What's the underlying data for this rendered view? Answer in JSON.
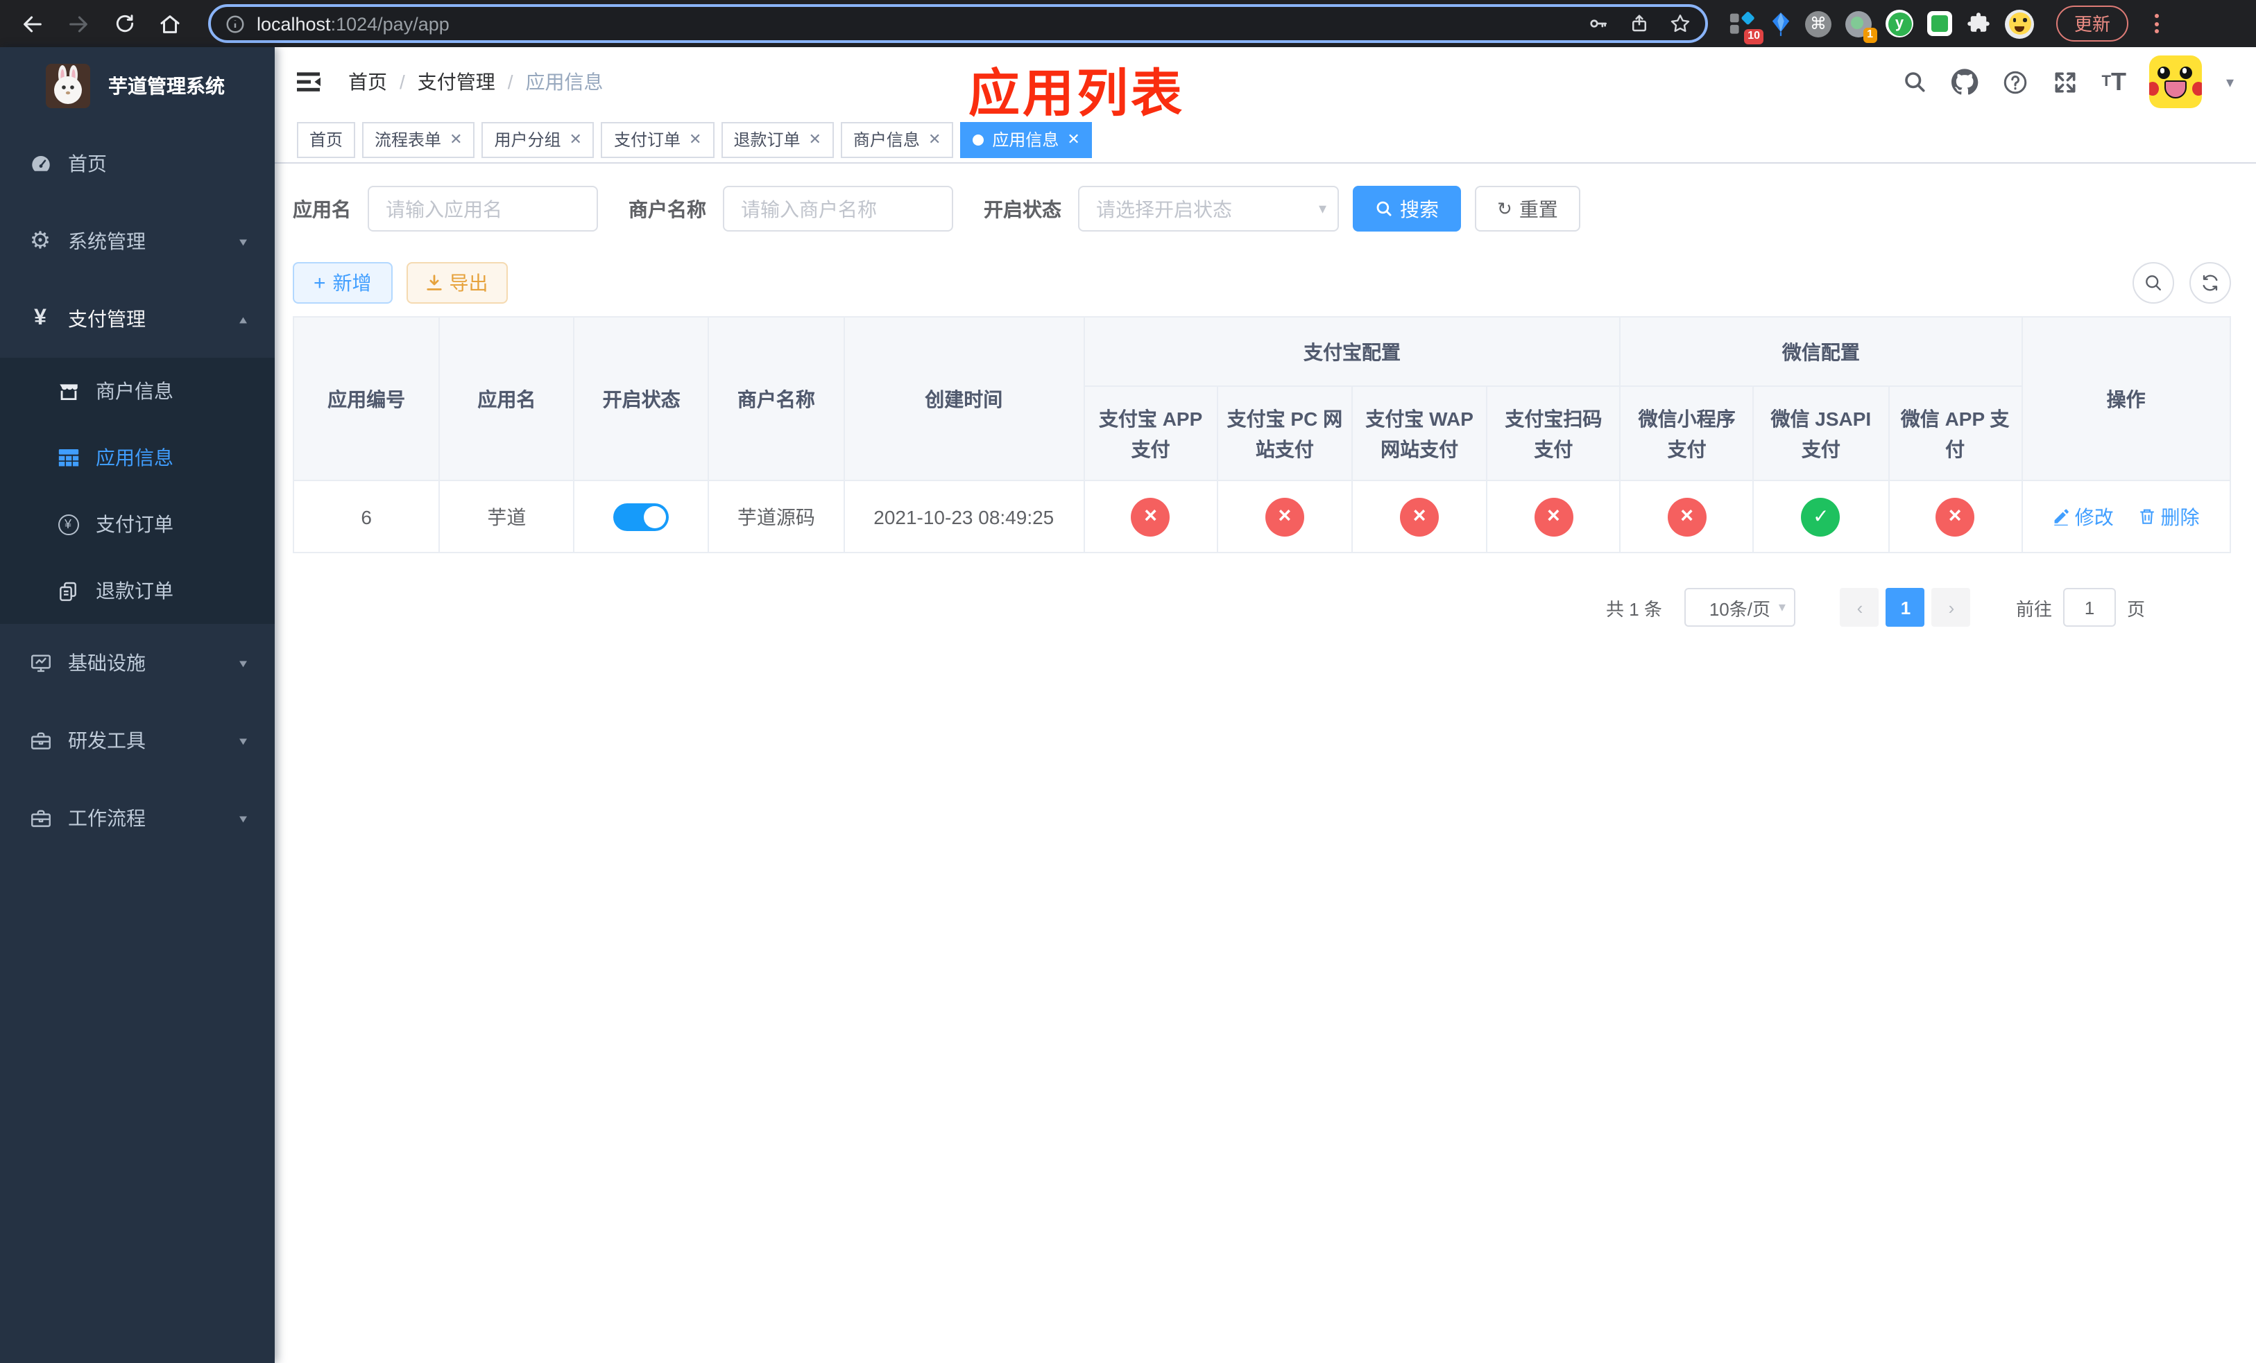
{
  "browser": {
    "url": {
      "host": "localhost",
      "rest": ":1024/pay/app"
    },
    "update_label": "更新",
    "ext_badges": {
      "blocks": "10",
      "rec": "1"
    }
  },
  "sidebar": {
    "title": "芋道管理系统",
    "menu": [
      {
        "label": "首页"
      },
      {
        "label": "系统管理"
      },
      {
        "label": "支付管理"
      },
      {
        "label": "基础设施"
      },
      {
        "label": "研发工具"
      },
      {
        "label": "工作流程"
      }
    ],
    "submenu": [
      {
        "label": "商户信息"
      },
      {
        "label": "应用信息"
      },
      {
        "label": "支付订单"
      },
      {
        "label": "退款订单"
      }
    ]
  },
  "navbar": {
    "breadcrumb": [
      "首页",
      "支付管理",
      "应用信息"
    ],
    "annotation": "应用列表"
  },
  "tabs": [
    {
      "label": "首页"
    },
    {
      "label": "流程表单"
    },
    {
      "label": "用户分组"
    },
    {
      "label": "支付订单"
    },
    {
      "label": "退款订单"
    },
    {
      "label": "商户信息"
    },
    {
      "label": "应用信息"
    }
  ],
  "filters": {
    "app_name": {
      "label": "应用名",
      "placeholder": "请输入应用名"
    },
    "merchant_name": {
      "label": "商户名称",
      "placeholder": "请输入商户名称"
    },
    "status": {
      "label": "开启状态",
      "placeholder": "请选择开启状态"
    },
    "search_label": "搜索",
    "reset_label": "重置"
  },
  "toolbar": {
    "add_label": "新增",
    "export_label": "导出"
  },
  "table": {
    "groups": {
      "alipay": "支付宝配置",
      "wechat": "微信配置"
    },
    "columns": {
      "id": "应用编号",
      "name": "应用名",
      "enabled": "开启状态",
      "merchant": "商户名称",
      "created": "创建时间",
      "alipay_app": "支付宝 APP 支付",
      "alipay_pc": "支付宝 PC 网站支付",
      "alipay_wap": "支付宝 WAP 网站支付",
      "alipay_qr": "支付宝扫码支付",
      "wx_mini": "微信小程序支付",
      "wx_jsapi": "微信 JSAPI 支付",
      "wx_app": "微信 APP 支付",
      "actions": "操作"
    },
    "row": {
      "id": "6",
      "name": "芋道",
      "enabled": true,
      "merchant": "芋道源码",
      "created": "2021-10-23 08:49:25",
      "statuses": [
        "no",
        "no",
        "no",
        "no",
        "no",
        "yes",
        "no"
      ],
      "edit_label": "修改",
      "delete_label": "删除"
    }
  },
  "pagination": {
    "total": "共 1 条",
    "page_size": "10条/页",
    "page": "1",
    "goto_label": "前往",
    "goto_value": "1",
    "unit_label": "页"
  }
}
